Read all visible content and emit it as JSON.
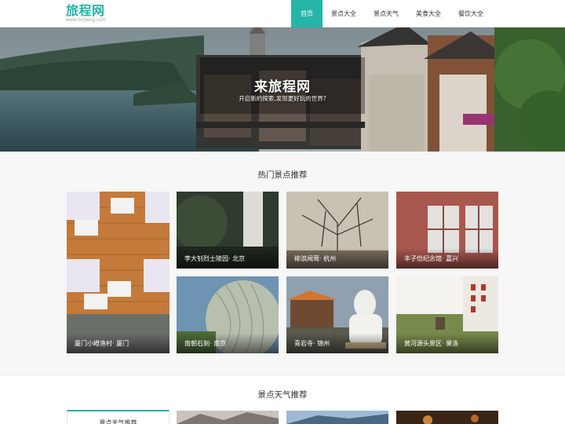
{
  "logo": {
    "main": "旅程网",
    "sub": "www.lvcheng.com"
  },
  "nav": [
    {
      "label": "首页",
      "active": true
    },
    {
      "label": "景点大全"
    },
    {
      "label": "景点天气"
    },
    {
      "label": "美食大全"
    },
    {
      "label": "餐饮大全"
    }
  ],
  "hero": {
    "title": "来旅程网",
    "subtitle": "开启新的探索,发现更好玩的世界?"
  },
  "hot": {
    "title": "热门景点推荐",
    "items": [
      {
        "caption": "厦门小嶝渔村· 厦门"
      },
      {
        "caption": "李大钊烈士陵园· 北京"
      },
      {
        "caption": "柳浪闻莺· 杭州"
      },
      {
        "caption": "丰子恺纪念馆· 嘉兴"
      },
      {
        "caption": "南朝石刻· 南京"
      },
      {
        "caption": "青岩寺· 锦州"
      },
      {
        "caption": "黄河源头景区· 果洛"
      }
    ]
  },
  "weather": {
    "title": "景点天气推荐",
    "card_title": "景点天气推荐"
  },
  "colors": {
    "accent": "#25b5a8",
    "logo": "#22b3a8"
  }
}
